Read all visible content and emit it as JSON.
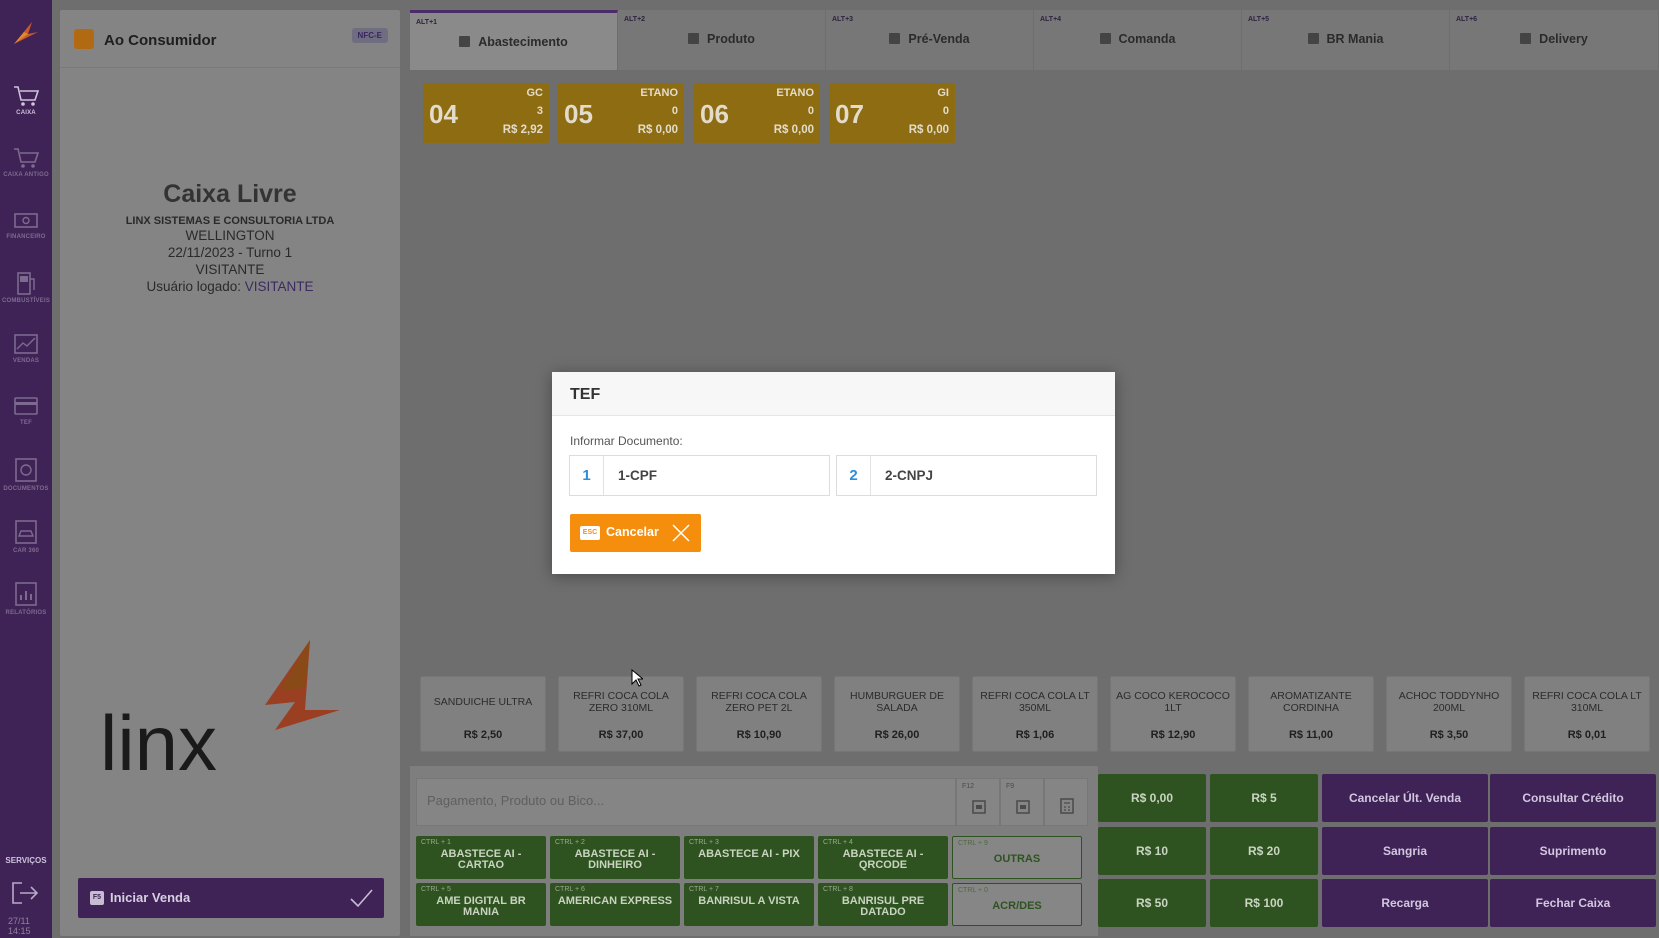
{
  "sidebar": {
    "items": [
      {
        "label": "CAIXA",
        "icon": "cart-icon"
      },
      {
        "label": "CAIXA ANTIGO",
        "icon": "cart-old-icon"
      },
      {
        "label": "FINANCEIRO",
        "icon": "money-icon"
      },
      {
        "label": "COMBUSTÍVEIS",
        "icon": "fuel-pump-icon"
      },
      {
        "label": "VENDAS",
        "icon": "chart-icon"
      },
      {
        "label": "TEF",
        "icon": "card-icon"
      },
      {
        "label": "DOCUMENTOS",
        "icon": "documents-icon"
      },
      {
        "label": "CAR 360",
        "icon": "car-icon"
      },
      {
        "label": "RELATÓRIOS",
        "icon": "reports-icon"
      }
    ],
    "services_label": "SERVIÇOS",
    "clock_date": "27/11",
    "clock_time": "14:15"
  },
  "left_panel": {
    "customer": "Ao Consumidor",
    "nfce_badge": "NFC-E",
    "status_title": "Caixa Livre",
    "company": "LINX SISTEMAS E CONSULTORIA LTDA",
    "operator": "WELLINGTON",
    "date_turn": "22/11/2023 - Turno 1",
    "visitor": "VISITANTE",
    "logged_prefix": "Usuário logado:",
    "logged_user": "VISITANTE",
    "start_key": "F5",
    "start_label": "Iniciar Venda"
  },
  "tabs": [
    {
      "key": "ALT+1",
      "label": "Abastecimento"
    },
    {
      "key": "ALT+2",
      "label": "Produto"
    },
    {
      "key": "ALT+3",
      "label": "Pré-Venda"
    },
    {
      "key": "ALT+4",
      "label": "Comanda"
    },
    {
      "key": "ALT+5",
      "label": "BR Mania"
    },
    {
      "key": "ALT+6",
      "label": "Delivery"
    }
  ],
  "pumps": [
    {
      "number": "04",
      "fuel": "GC",
      "count": "3",
      "value": "R$ 2,92"
    },
    {
      "number": "05",
      "fuel": "ETANO",
      "count": "0",
      "value": "R$ 0,00"
    },
    {
      "number": "06",
      "fuel": "ETANO",
      "count": "0",
      "value": "R$ 0,00"
    },
    {
      "number": "07",
      "fuel": "GI",
      "count": "0",
      "value": "R$ 0,00"
    }
  ],
  "products": [
    {
      "name": "SANDUICHE ULTRA",
      "price": "R$ 2,50"
    },
    {
      "name": "REFRI COCA COLA ZERO 310ML",
      "price": "R$ 37,00"
    },
    {
      "name": "REFRI COCA COLA ZERO PET 2L",
      "price": "R$ 10,90"
    },
    {
      "name": "HUMBURGUER DE SALADA",
      "price": "R$ 26,00"
    },
    {
      "name": "REFRI COCA COLA LT 350ML",
      "price": "R$ 1,06"
    },
    {
      "name": "AG COCO KEROCOCO 1LT",
      "price": "R$ 12,90"
    },
    {
      "name": "AROMATIZANTE CORDINHA",
      "price": "R$ 11,00"
    },
    {
      "name": "ACHOC TODDYNHO 200ML",
      "price": "R$ 3,50"
    },
    {
      "name": "REFRI COCA COLA LT 310ML",
      "price": "R$ 0,01"
    }
  ],
  "search": {
    "placeholder": "Pagamento, Produto ou Bico...",
    "btn1_key": "F12",
    "btn2_key": "F9"
  },
  "quick_buttons": [
    {
      "key": "CTRL + 1",
      "label": "ABASTECE AI - CARTAO"
    },
    {
      "key": "CTRL + 2",
      "label": "ABASTECE AI - DINHEIRO"
    },
    {
      "key": "CTRL + 3",
      "label": "ABASTECE AI - PIX"
    },
    {
      "key": "CTRL + 4",
      "label": "ABASTECE AI - QRCODE"
    },
    {
      "key": "CTRL + 9",
      "label": "OUTRAS"
    },
    {
      "key": "CTRL + 5",
      "label": "AME DIGITAL BR MANIA"
    },
    {
      "key": "CTRL + 6",
      "label": "AMERICAN EXPRESS"
    },
    {
      "key": "CTRL + 7",
      "label": "BANRISUL A VISTA"
    },
    {
      "key": "CTRL + 8",
      "label": "BANRISUL PRE DATADO"
    },
    {
      "key": "CTRL + 0",
      "label": "ACR/DES"
    }
  ],
  "cash_buttons": [
    "R$ 0,00",
    "R$ 5",
    "R$ 10",
    "R$ 20",
    "R$ 50",
    "R$ 100"
  ],
  "action_buttons": [
    "Cancelar Últ. Venda",
    "Consultar Crédito",
    "Sangria",
    "Suprimento",
    "Recarga",
    "Fechar Caixa"
  ],
  "modal": {
    "title": "TEF",
    "label": "Informar Documento:",
    "options": [
      {
        "num": "1",
        "label": "1-CPF"
      },
      {
        "num": "2",
        "label": "2-CNPJ"
      }
    ],
    "cancel_key": "ESC",
    "cancel_label": "Cancelar"
  },
  "colors": {
    "brand_purple": "#6a3d95",
    "pump_gold": "#e5b021",
    "cash_green": "#5a9a3e",
    "cancel_orange": "#f58e0c",
    "option_blue": "#2c8fd8"
  }
}
